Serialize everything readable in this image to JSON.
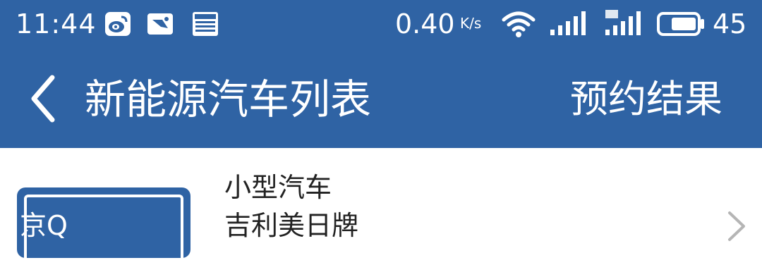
{
  "status_bar": {
    "time": "11:44",
    "net_speed": "0.40",
    "net_speed_unit": "K/s",
    "battery_percent": "45",
    "icons": [
      "weibo-icon",
      "image-notification-icon",
      "news-icon",
      "wifi-icon",
      "signal-icon",
      "signal-4g-icon",
      "battery-icon"
    ]
  },
  "app_bar": {
    "title": "新能源汽车列表",
    "action_label": "预约结果",
    "back_icon": "back-arrow-icon"
  },
  "list": {
    "items": [
      {
        "plate": "京Q",
        "type": "小型汽车",
        "brand": "吉利美日牌",
        "chevron_icon": "chevron-right-icon"
      }
    ]
  },
  "colors": {
    "primary": "#2f63a4",
    "text": "#222222",
    "chevron": "#b5b5b5"
  }
}
